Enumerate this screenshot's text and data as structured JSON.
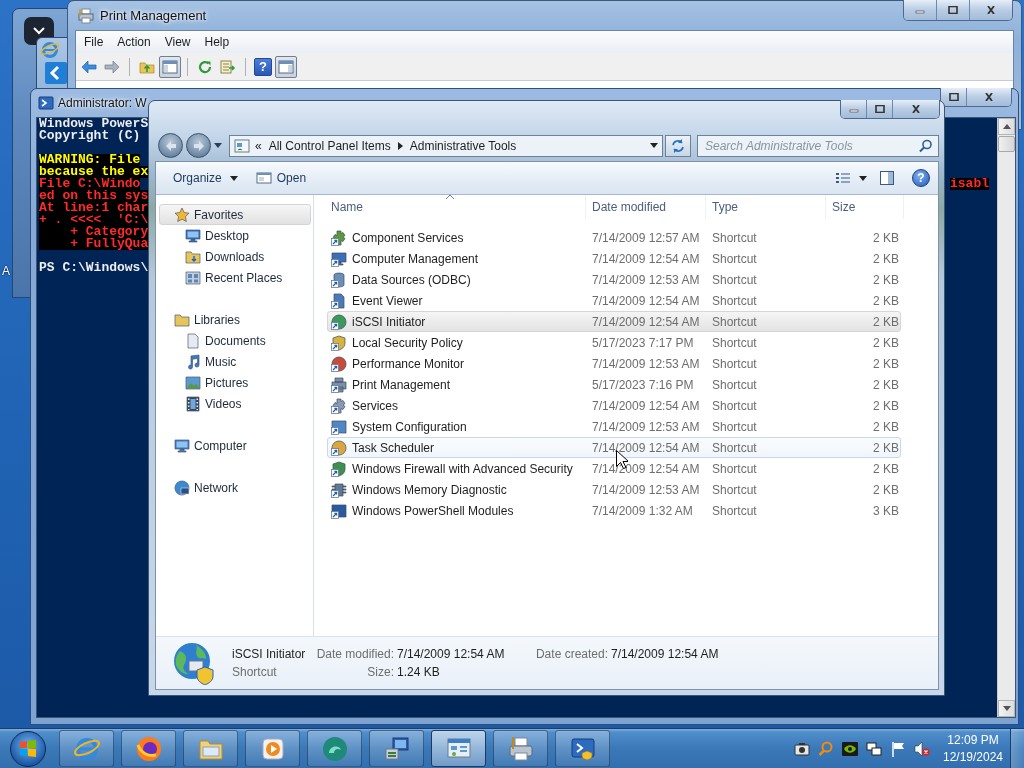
{
  "desktop": {
    "icon_label": "A"
  },
  "print_management": {
    "title": "Print Management",
    "menu": [
      "File",
      "Action",
      "View",
      "Help"
    ],
    "toolbar_groups": [
      {
        "buttons": [
          {
            "kind": "back",
            "pressed": false
          },
          {
            "kind": "forward",
            "pressed": false
          }
        ]
      },
      {
        "buttons": [
          {
            "kind": "up",
            "pressed": false
          },
          {
            "kind": "tree",
            "pressed": true
          }
        ]
      },
      {
        "buttons": [
          {
            "kind": "refresh",
            "pressed": false
          },
          {
            "kind": "export",
            "pressed": false
          }
        ]
      },
      {
        "buttons": [
          {
            "kind": "help",
            "pressed": false,
            "glyph": "?"
          },
          {
            "kind": "pane",
            "pressed": true
          }
        ]
      }
    ]
  },
  "powershell": {
    "title": "Administrator: W",
    "blocks": [
      {
        "lines": [
          {
            "text": "Windows PowerS",
            "kind": "output"
          },
          {
            "text": "Copyright (C)",
            "kind": "output"
          }
        ]
      },
      {
        "lines": [
          {
            "text": "WARNING: File",
            "kind": "warning"
          },
          {
            "text": "because the ex",
            "kind": "warning"
          },
          {
            "text": "File C:\\Windo",
            "kind": "error",
            "tail": "isabl"
          },
          {
            "text": "ed on this sys",
            "kind": "error"
          },
          {
            "text": "At line:1 char",
            "kind": "error"
          },
          {
            "text": "+ . <<<<  'C:\\",
            "kind": "error"
          },
          {
            "text": "    + Category",
            "kind": "error"
          },
          {
            "text": "    + FullyQua",
            "kind": "error"
          }
        ]
      },
      {
        "lines": [
          {
            "text": "PS C:\\Windows\\",
            "kind": "output"
          }
        ]
      }
    ]
  },
  "explorer": {
    "address": {
      "overflow": "«",
      "crumbs": [
        "All Control Panel Items",
        "Administrative Tools"
      ]
    },
    "search": {
      "placeholder": "Search Administrative Tools"
    },
    "commands": {
      "organize": "Organize",
      "open": "Open",
      "help_glyph": "?"
    },
    "nav": [
      {
        "label": "Favorites",
        "kind": "favorites",
        "selected": true,
        "children": [
          {
            "label": "Desktop",
            "kind": "desktop",
            "selected": false
          },
          {
            "label": "Downloads",
            "kind": "downloads",
            "selected": false
          },
          {
            "label": "Recent Places",
            "kind": "recent",
            "selected": false
          }
        ]
      },
      {
        "label": "Libraries",
        "kind": "libraries",
        "selected": false,
        "children": [
          {
            "label": "Documents",
            "kind": "documents",
            "selected": false
          },
          {
            "label": "Music",
            "kind": "music",
            "selected": false
          },
          {
            "label": "Pictures",
            "kind": "pictures",
            "selected": false
          },
          {
            "label": "Videos",
            "kind": "videos",
            "selected": false
          }
        ]
      },
      {
        "label": "Computer",
        "kind": "computer",
        "selected": false
      },
      {
        "label": "Network",
        "kind": "network",
        "selected": false
      }
    ],
    "columns": [
      {
        "label": "Name",
        "sorted": true
      },
      {
        "label": "Date modified",
        "sorted": false
      },
      {
        "label": "Type",
        "sorted": false
      },
      {
        "label": "Size",
        "sorted": false
      }
    ],
    "rows": [
      {
        "kind": "component",
        "name": "Component Services",
        "date": "7/14/2009 12:57 AM",
        "type": "Shortcut",
        "size": "2 KB",
        "selected": false,
        "hovered": false
      },
      {
        "kind": "computer",
        "name": "Computer Management",
        "date": "7/14/2009 12:54 AM",
        "type": "Shortcut",
        "size": "2 KB",
        "selected": false,
        "hovered": false
      },
      {
        "kind": "odbc",
        "name": "Data Sources (ODBC)",
        "date": "7/14/2009 12:53 AM",
        "type": "Shortcut",
        "size": "2 KB",
        "selected": false,
        "hovered": false
      },
      {
        "kind": "events",
        "name": "Event Viewer",
        "date": "7/14/2009 12:54 AM",
        "type": "Shortcut",
        "size": "2 KB",
        "selected": false,
        "hovered": false
      },
      {
        "kind": "iscsi",
        "name": "iSCSI Initiator",
        "date": "7/14/2009 12:54 AM",
        "type": "Shortcut",
        "size": "2 KB",
        "selected": true,
        "hovered": false
      },
      {
        "kind": "security",
        "name": "Local Security Policy",
        "date": "5/17/2023 7:17 PM",
        "type": "Shortcut",
        "size": "2 KB",
        "selected": false,
        "hovered": false
      },
      {
        "kind": "performance",
        "name": "Performance Monitor",
        "date": "7/14/2009 12:53 AM",
        "type": "Shortcut",
        "size": "2 KB",
        "selected": false,
        "hovered": false
      },
      {
        "kind": "print",
        "name": "Print Management",
        "date": "5/17/2023 7:16 PM",
        "type": "Shortcut",
        "size": "2 KB",
        "selected": false,
        "hovered": false
      },
      {
        "kind": "services",
        "name": "Services",
        "date": "7/14/2009 12:54 AM",
        "type": "Shortcut",
        "size": "2 KB",
        "selected": false,
        "hovered": false
      },
      {
        "kind": "sysconfig",
        "name": "System Configuration",
        "date": "7/14/2009 12:53 AM",
        "type": "Shortcut",
        "size": "2 KB",
        "selected": false,
        "hovered": false
      },
      {
        "kind": "tasks",
        "name": "Task Scheduler",
        "date": "7/14/2009 12:54 AM",
        "type": "Shortcut",
        "size": "2 KB",
        "selected": false,
        "hovered": true
      },
      {
        "kind": "firewall",
        "name": "Windows Firewall with Advanced Security",
        "date": "7/14/2009 12:54 AM",
        "type": "Shortcut",
        "size": "2 KB",
        "selected": false,
        "hovered": false
      },
      {
        "kind": "memory",
        "name": "Windows Memory Diagnostic",
        "date": "7/14/2009 12:53 AM",
        "type": "Shortcut",
        "size": "2 KB",
        "selected": false,
        "hovered": false
      },
      {
        "kind": "console",
        "name": "Windows PowerShell Modules",
        "date": "7/14/2009 1:32 AM",
        "type": "Shortcut",
        "size": "3 KB",
        "selected": false,
        "hovered": false
      }
    ],
    "details": {
      "name": "iSCSI Initiator",
      "type": "Shortcut",
      "fields": [
        {
          "label": "Date modified:",
          "value": "7/14/2009 12:54 AM"
        },
        {
          "label": "Size:",
          "value": "1.24 KB"
        },
        {
          "label": "Date created:",
          "value": "7/14/2009 12:54 AM"
        }
      ]
    }
  },
  "taskbar": {
    "buttons": [
      {
        "kind": "browser-e",
        "selected": false
      },
      {
        "kind": "browser-fox",
        "selected": false
      },
      {
        "kind": "folder",
        "selected": false
      },
      {
        "kind": "media",
        "selected": false
      },
      {
        "kind": "swirl",
        "selected": false
      },
      {
        "kind": "computer",
        "selected": false
      },
      {
        "kind": "panel",
        "selected": true
      },
      {
        "kind": "printer",
        "selected": false
      },
      {
        "kind": "console",
        "selected": false
      }
    ],
    "tray": {
      "volume_muted": true
    },
    "clock": {
      "time": "12:09 PM",
      "date": "12/19/2024"
    }
  }
}
